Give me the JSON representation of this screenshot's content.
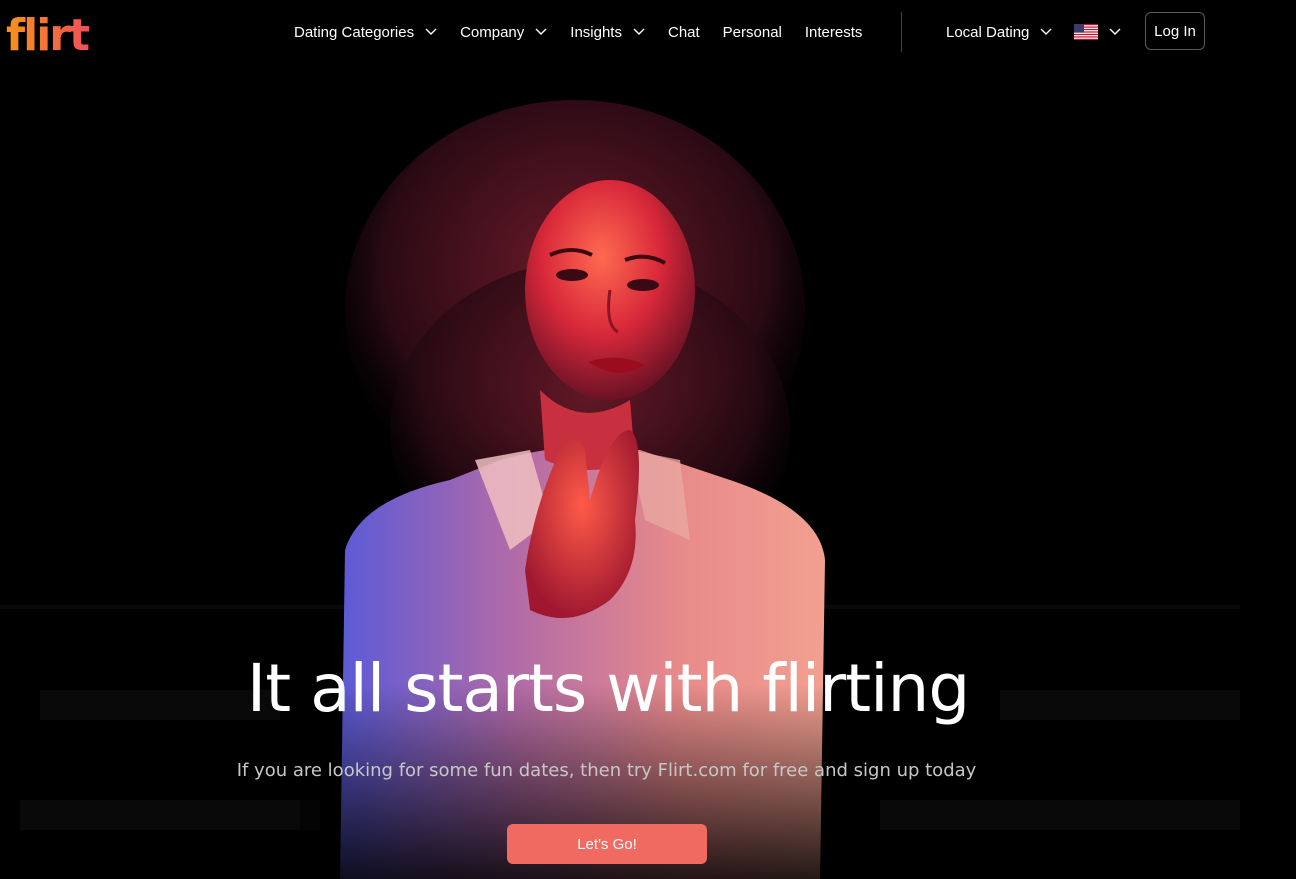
{
  "brand": {
    "logo_text": "flirt",
    "colors": {
      "accent": "#f06a62",
      "logo_start": "#f7931e",
      "logo_end": "#ef4f59"
    }
  },
  "nav": {
    "items": [
      {
        "label": "Dating Categories",
        "has_dropdown": true
      },
      {
        "label": "Company",
        "has_dropdown": true
      },
      {
        "label": "Insights",
        "has_dropdown": true
      },
      {
        "label": "Chat",
        "has_dropdown": false
      },
      {
        "label": "Personal",
        "has_dropdown": false
      },
      {
        "label": "Interests",
        "has_dropdown": false
      }
    ],
    "local_dating": "Local Dating",
    "language_icon": "us-flag-icon",
    "login": "Log In"
  },
  "hero": {
    "title": "It all starts with flirting",
    "subtitle": "If you are looking for some fun dates, then try Flirt.com for free and sign up today",
    "cta": "Let's Go!"
  }
}
